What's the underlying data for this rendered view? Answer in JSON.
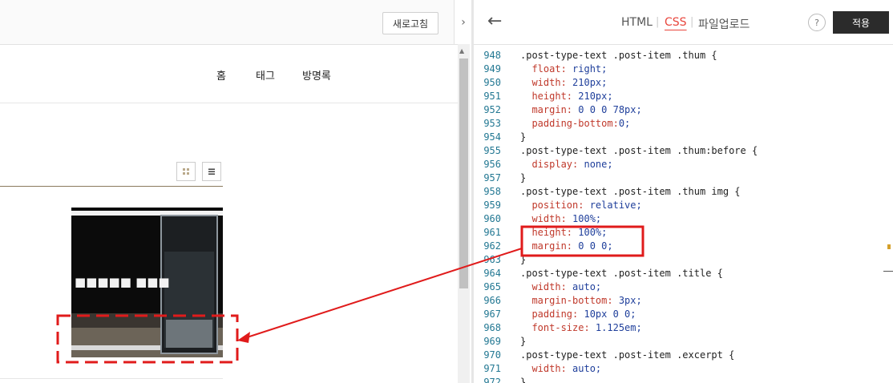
{
  "preview": {
    "refresh_label": "새로고침",
    "nav": {
      "home": "홈",
      "tag": "태그",
      "guestbook": "방명록"
    },
    "view_icons": {
      "grid": "grid-icon",
      "list": "list-icon"
    },
    "thumbnail_text": "■■■■■ ■■■"
  },
  "editor": {
    "tabs": {
      "html": "HTML",
      "css": "CSS",
      "upload": "파일업로드"
    },
    "separator": "|",
    "help": "?",
    "apply_label": "적용",
    "collapse_icon": "chevron-right-icon",
    "back_icon": "arrow-left-icon",
    "active_tab_color": "#e8453c",
    "lines": [
      {
        "n": "948",
        "t": ".post-type-text .post-item .thum {",
        "k": "sel"
      },
      {
        "n": "949",
        "t": "  float: right;",
        "k": "prop"
      },
      {
        "n": "950",
        "t": "  width: 210px;",
        "k": "prop"
      },
      {
        "n": "951",
        "t": "  height: 210px;",
        "k": "prop"
      },
      {
        "n": "952",
        "t": "  margin: 0 0 0 78px;",
        "k": "prop"
      },
      {
        "n": "953",
        "t": "  padding-bottom:0;",
        "k": "prop"
      },
      {
        "n": "954",
        "t": "}",
        "k": "sel"
      },
      {
        "n": "955",
        "t": ".post-type-text .post-item .thum:before {",
        "k": "sel"
      },
      {
        "n": "956",
        "t": "  display: none;",
        "k": "prop"
      },
      {
        "n": "957",
        "t": "}",
        "k": "sel"
      },
      {
        "n": "958",
        "t": ".post-type-text .post-item .thum img {",
        "k": "sel"
      },
      {
        "n": "959",
        "t": "  position: relative;",
        "k": "prop"
      },
      {
        "n": "960",
        "t": "  width: 100%;",
        "k": "prop"
      },
      {
        "n": "961",
        "t": "  height: 100%;",
        "k": "prop"
      },
      {
        "n": "962",
        "t": "  margin: 0 0 0;",
        "k": "prop"
      },
      {
        "n": "963",
        "t": "}",
        "k": "sel"
      },
      {
        "n": "964",
        "t": ".post-type-text .post-item .title {",
        "k": "sel"
      },
      {
        "n": "965",
        "t": "  width: auto;",
        "k": "prop"
      },
      {
        "n": "966",
        "t": "  margin-bottom: 3px;",
        "k": "prop"
      },
      {
        "n": "967",
        "t": "  padding: 10px 0 0;",
        "k": "prop"
      },
      {
        "n": "968",
        "t": "  font-size: 1.125em;",
        "k": "prop"
      },
      {
        "n": "969",
        "t": "}",
        "k": "sel"
      },
      {
        "n": "970",
        "t": ".post-type-text .post-item .excerpt {",
        "k": "sel"
      },
      {
        "n": "971",
        "t": "  width: auto;",
        "k": "prop"
      },
      {
        "n": "972",
        "t": "}",
        "k": "sel"
      }
    ]
  },
  "annotation": {
    "color": "#e01b1b"
  }
}
